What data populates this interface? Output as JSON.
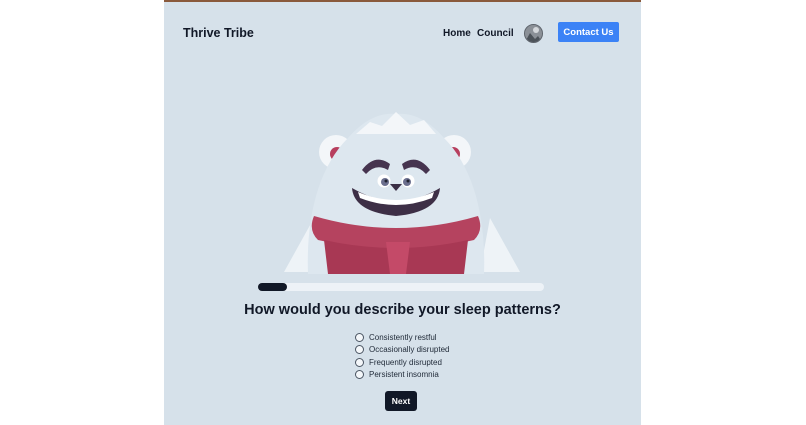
{
  "header": {
    "brand": "Thrive Tribe",
    "nav": [
      {
        "label": "Home"
      },
      {
        "label": "Council"
      }
    ],
    "contact_label": "Contact Us"
  },
  "mascot": {
    "icon": "yeti-mascot-illustration"
  },
  "progress": {
    "fraction": 0.1
  },
  "question": {
    "text": "How would you describe your sleep patterns?",
    "options": [
      {
        "label": "Consistently restful"
      },
      {
        "label": "Occasionally disrupted"
      },
      {
        "label": "Frequently disrupted"
      },
      {
        "label": "Persistent insomnia"
      }
    ]
  },
  "next_label": "Next",
  "colors": {
    "panel_bg": "#d6e1ea",
    "accent": "#3b82f6",
    "dark": "#111827"
  }
}
